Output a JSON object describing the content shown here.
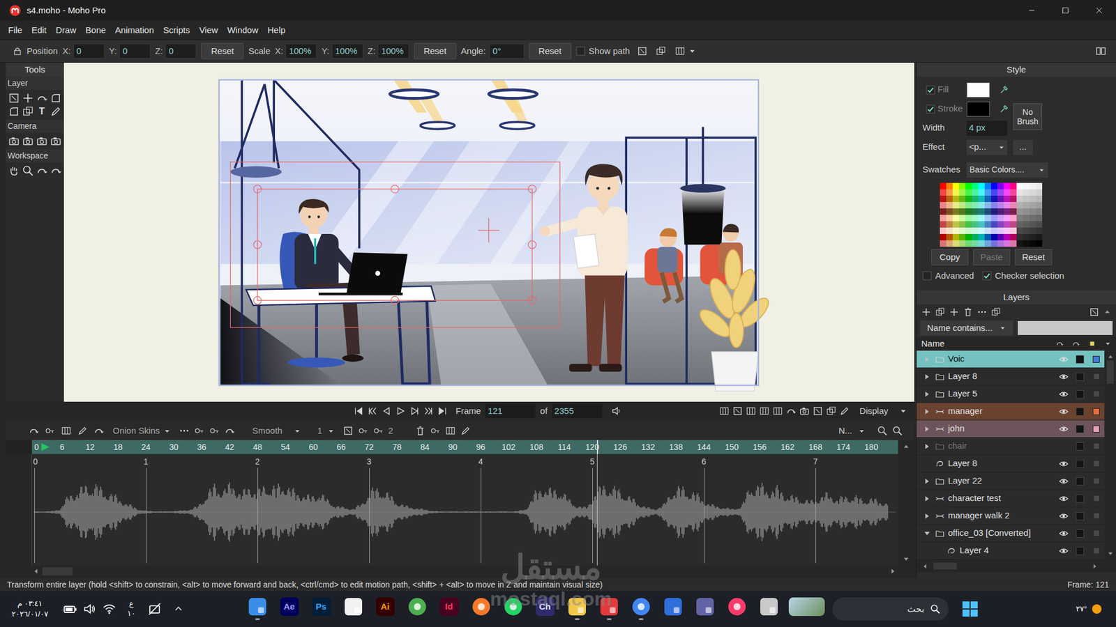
{
  "window": {
    "title": "s4.moho - Moho Pro"
  },
  "menu": [
    "File",
    "Edit",
    "Draw",
    "Bone",
    "Animation",
    "Scripts",
    "View",
    "Window",
    "Help"
  ],
  "toolbar": {
    "position": {
      "label": "Position",
      "fields": [
        {
          "axis": "X:",
          "value": "0"
        },
        {
          "axis": "Y:",
          "value": "0"
        },
        {
          "axis": "Z:",
          "value": "0"
        }
      ],
      "reset": "Reset"
    },
    "scale": {
      "label": "Scale",
      "fields": [
        {
          "axis": "X:",
          "value": "100%"
        },
        {
          "axis": "Y:",
          "value": "100%"
        },
        {
          "axis": "Z:",
          "value": "100%"
        }
      ],
      "reset": "Reset"
    },
    "angle": {
      "label": "Angle:",
      "value": "0°",
      "reset": "Reset"
    },
    "show_path": {
      "label": "Show path",
      "checked": false
    }
  },
  "tools": {
    "title": "Tools",
    "sections": [
      {
        "label": "Layer"
      },
      {
        "label": "Camera"
      },
      {
        "label": "Workspace"
      }
    ],
    "text_tool": "T"
  },
  "style": {
    "title": "Style",
    "fill": {
      "label": "Fill",
      "checked": true,
      "color": "#ffffff"
    },
    "stroke": {
      "label": "Stroke",
      "checked": true,
      "color": "#000000"
    },
    "width": {
      "label": "Width",
      "value": "4 px"
    },
    "brush": "No Brush",
    "effect": {
      "label": "Effect",
      "value": "<p...",
      "more": "..."
    },
    "swatches": {
      "label": "Swatches",
      "value": "Basic Colors...."
    },
    "buttons": [
      {
        "label": "Copy",
        "disabled": false
      },
      {
        "label": "Paste",
        "disabled": true
      },
      {
        "label": "Reset",
        "disabled": false
      }
    ],
    "advanced": {
      "label": "Advanced",
      "checked": false
    },
    "checker": {
      "label": "Checker selection",
      "checked": true
    }
  },
  "layers": {
    "title": "Layers",
    "filter": "Name contains...",
    "column": "Name",
    "rows": [
      {
        "name": "Voic",
        "kind": "group",
        "depth": 0,
        "expanded": false,
        "visible": true,
        "selected": true,
        "color": "#4a78d6"
      },
      {
        "name": "Layer 8",
        "kind": "group",
        "depth": 0,
        "expanded": false,
        "visible": true,
        "selected": false,
        "color": null
      },
      {
        "name": "Layer 5",
        "kind": "group",
        "depth": 0,
        "expanded": false,
        "visible": true,
        "selected": false,
        "color": null
      },
      {
        "name": "manager",
        "kind": "bone",
        "depth": 0,
        "expanded": false,
        "visible": true,
        "selected": false,
        "color": "#e0703a"
      },
      {
        "name": "john",
        "kind": "bone",
        "depth": 0,
        "expanded": false,
        "visible": true,
        "selected": false,
        "color": "#e8a0b4"
      },
      {
        "name": "chair",
        "kind": "group",
        "depth": 0,
        "expanded": false,
        "visible": false,
        "selected": false,
        "color": null
      },
      {
        "name": "Layer 8",
        "kind": "vector",
        "depth": 0,
        "visible": true,
        "selected": false,
        "color": null
      },
      {
        "name": "Layer 22",
        "kind": "group",
        "depth": 0,
        "expanded": false,
        "visible": true,
        "selected": false,
        "color": null
      },
      {
        "name": "character test",
        "kind": "bone",
        "depth": 0,
        "expanded": false,
        "visible": true,
        "selected": false,
        "color": null
      },
      {
        "name": "manager walk 2",
        "kind": "bone",
        "depth": 0,
        "expanded": false,
        "visible": true,
        "selected": false,
        "color": null
      },
      {
        "name": "office_03 [Converted]",
        "kind": "group",
        "depth": 0,
        "expanded": true,
        "visible": true,
        "selected": false,
        "color": null
      },
      {
        "name": "Layer 4",
        "kind": "vector",
        "depth": 1,
        "visible": true,
        "selected": false,
        "color": null
      }
    ]
  },
  "playback": {
    "frame_label": "Frame",
    "frame": "121",
    "of_label": "of",
    "total": "2355",
    "display": "Display"
  },
  "timeline": {
    "onion_skins": "Onion Skins",
    "interpolation": "Smooth",
    "step": "1",
    "keys": "2",
    "channels": "N...",
    "ruler": [
      "0",
      "6",
      "12",
      "18",
      "24",
      "30",
      "36",
      "42",
      "48",
      "54",
      "60",
      "66",
      "72",
      "78",
      "84",
      "90",
      "96",
      "102",
      "108",
      "114",
      "120",
      "126",
      "132",
      "138",
      "144",
      "150",
      "156",
      "162",
      "168",
      "174",
      "180"
    ],
    "playhead_frame": 121,
    "seconds": [
      "0",
      "1",
      "2",
      "3",
      "4",
      "5",
      "6",
      "7"
    ],
    "waveform": [
      0.02,
      0.02,
      0.03,
      0.1,
      0.55,
      0.7,
      0.85,
      0.9,
      0.7,
      0.6,
      0.4,
      0.25,
      0.1,
      0.04,
      0.03,
      0.02,
      0.03,
      0.05,
      0.08,
      0.2,
      0.6,
      0.9,
      0.75,
      0.95,
      0.6,
      0.85,
      0.7,
      0.9,
      0.8,
      0.95,
      0.7,
      0.6,
      0.5,
      0.65,
      0.4,
      0.2,
      0.15,
      0.1,
      0.3,
      0.7,
      0.8,
      0.6,
      0.35,
      0.2,
      0.15,
      0.1,
      0.05,
      0.02,
      0.02,
      0.02,
      0.02,
      0.02,
      0.02,
      0.02,
      0.02,
      0.02,
      0.03,
      0.1,
      0.6,
      0.85,
      0.7,
      0.75,
      0.4,
      0.2,
      0.15,
      0.6,
      0.9,
      0.8,
      0.7,
      0.5,
      0.3,
      0.15,
      0.1,
      0.25,
      0.75,
      0.8,
      0.7,
      0.55,
      0.3,
      0.2,
      0.15,
      0.1,
      0.2,
      0.85,
      0.9,
      0.75,
      0.8,
      0.6,
      0.5,
      0.45,
      0.35,
      0.5,
      0.6,
      0.45,
      0.5,
      0.55,
      0.4,
      0.45,
      0.35,
      0.3
    ]
  },
  "status": {
    "hint": "Transform entire layer (hold <shift> to constrain, <alt> to move forward and back, <ctrl/cmd> to edit motion path, <shift> + <alt> to move in Z and maintain visual size)",
    "frame": "Frame: 121"
  },
  "taskbar": {
    "time": "٠٣:٤١ م",
    "date": "٢٠٢٦/٠١/٠٧",
    "lang": "ع",
    "lang_sub": "١٠",
    "apps": [
      {
        "kind": "tile",
        "color": "#3b8ee8",
        "running": true
      },
      {
        "kind": "badge",
        "label": "Ae",
        "color": "#9999ff",
        "bg": "#00005b",
        "running": false
      },
      {
        "kind": "badge",
        "label": "Ps",
        "color": "#31a8ff",
        "bg": "#001e36",
        "running": false
      },
      {
        "kind": "tile",
        "color": "#f2f2f2",
        "running": false
      },
      {
        "kind": "badge",
        "label": "Ai",
        "color": "#ff9a00",
        "bg": "#330000",
        "running": false
      },
      {
        "kind": "circle",
        "color": "#4caf50",
        "running": false
      },
      {
        "kind": "badge",
        "label": "Id",
        "color": "#ff3366",
        "bg": "#49021f",
        "running": false
      },
      {
        "kind": "circle",
        "color": "#f5792a",
        "running": false
      },
      {
        "kind": "circle",
        "color": "#25d366",
        "running": false
      },
      {
        "kind": "badge",
        "label": "Ch",
        "color": "#e6e6ff",
        "bg": "#2d2a6e",
        "running": false
      },
      {
        "kind": "tile",
        "color": "#f2c84b",
        "running": true
      },
      {
        "kind": "tile",
        "color": "#e03a3a",
        "running": true
      },
      {
        "kind": "circle",
        "color": "#4285f4",
        "running": true
      },
      {
        "kind": "tile",
        "color": "#2f6fdc",
        "running": false
      },
      {
        "kind": "tile",
        "color": "#6264a7",
        "running": false
      },
      {
        "kind": "circle",
        "color": "#fa3c6b",
        "running": false
      },
      {
        "kind": "tile",
        "color": "#c9c9c9",
        "running": false
      },
      {
        "kind": "wide",
        "color": "#6a8f5a",
        "running": false
      }
    ],
    "search": "بحث",
    "weather": "٢٧°"
  },
  "watermark": {
    "arabic": "مستقل",
    "latin": "mostaql.com"
  }
}
